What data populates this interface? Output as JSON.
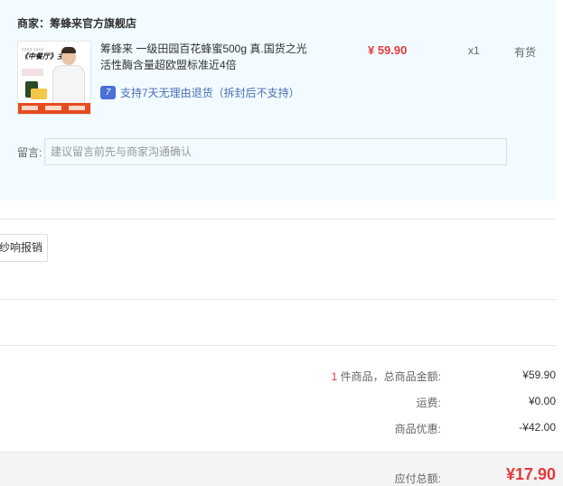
{
  "shop": {
    "name": "商家：筹蜂来官方旗舰店",
    "product": {
      "title": "筹蜂来 一级田园百花蜂蜜500g 真.国货之光 活性酶含量超欧盟标准近4倍",
      "thumbnail_text": "《中餐厅》主厨",
      "return_badge": "7",
      "return_policy": "支持7天无理由退货（拆封后不支持）",
      "price": "¥ 59.90",
      "quantity": "x1",
      "stock": "有货"
    },
    "message": {
      "label": "留言:",
      "placeholder": "建议留言前先与商家沟通确认"
    }
  },
  "invoice": {
    "button_label": "纱响报销"
  },
  "summary": {
    "item_count": "1",
    "item_count_label": " 件商品，总商品金额:",
    "goods_total": "¥59.90",
    "shipping_label": "运费:",
    "shipping": "¥0.00",
    "discount_label": "商品优惠:",
    "discount": "-¥42.00",
    "payable_label": "应付总额:",
    "payable": "¥17.90"
  },
  "colors": {
    "accent_red": "#e4393c",
    "panel_bg": "#f2fbff",
    "link_blue": "#4a6fb5"
  }
}
